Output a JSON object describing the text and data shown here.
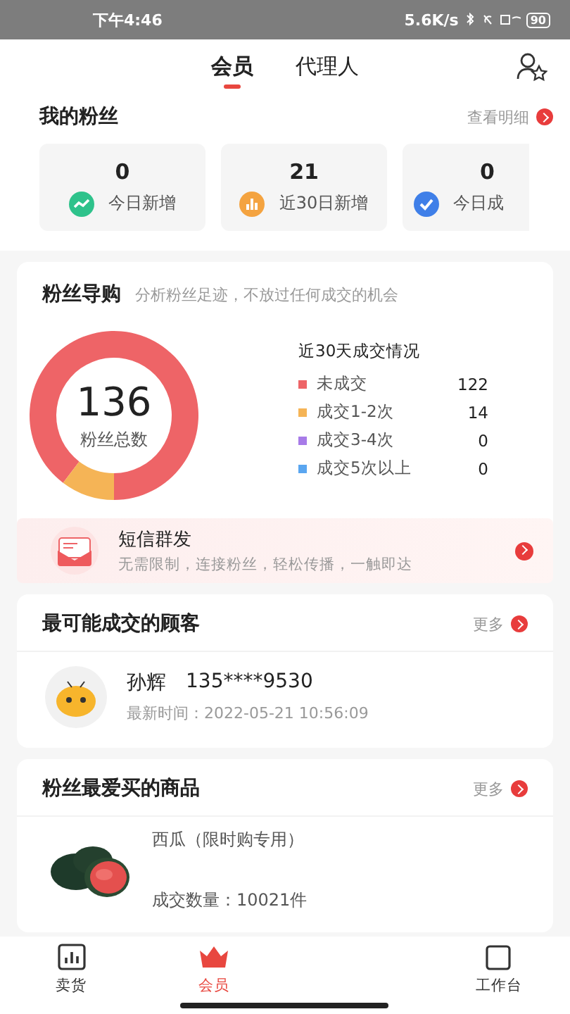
{
  "status_bar": {
    "time": "下午4:46",
    "speed": "5.6K/s",
    "battery": "90"
  },
  "tabs": [
    {
      "label": "会员",
      "selected": true
    },
    {
      "label": "代理人",
      "selected": false
    }
  ],
  "my_fans": {
    "title": "我的粉丝",
    "link": "查看明细",
    "stats": [
      {
        "value": "0",
        "label": "今日新增",
        "kind": "trend",
        "color": "#2ec28b"
      },
      {
        "value": "21",
        "label": "近30日新增",
        "kind": "bars",
        "color": "#f4a340"
      },
      {
        "value": "0",
        "label": "今日成",
        "kind": "check",
        "color": "#3f7fe8"
      }
    ]
  },
  "fan_guide": {
    "title": "粉丝导购",
    "subtitle": "分析粉丝足迹，不放过任何成交的机会",
    "total": "136",
    "total_label": "粉丝总数",
    "legend_title": "近30天成交情况",
    "legend": [
      {
        "count": "122",
        "color": "#ee6467"
      },
      {
        "count": "14",
        "color": "#f5b456"
      },
      {
        "count": "0",
        "color": "#a77be8"
      },
      {
        "count": "0",
        "color": "#5aa6f0"
      }
    ],
    "chart_data": {
      "type": "donut",
      "categories": [
        "未成交",
        "成交1-2次",
        "成交3-4次",
        "成交5次以上"
      ],
      "values": [
        89.7,
        10.3,
        0,
        0
      ]
    },
    "sms": {
      "title": "短信群发",
      "subtitle": "无需限制，连接粉丝，轻松传播，一触即达"
    }
  },
  "customers": {
    "title": "最可能成交的顾客",
    "link": "更多",
    "items": [
      {
        "name": "孙辉",
        "phone": "135****9530",
        "time": "最新时间：2022-05-21 10:56:09"
      }
    ]
  },
  "products": {
    "title": "粉丝最爱买的商品",
    "link": "更多",
    "items": [
      {
        "name": "西瓜（限时购专用）",
        "sales": "成交数量：10021件"
      }
    ]
  },
  "nav": [
    {
      "label": "卖货",
      "kind": "chart",
      "selected": false
    },
    {
      "label": "会员",
      "kind": "crown",
      "selected": true
    },
    {
      "label": "工作台",
      "kind": "grid",
      "selected": false
    }
  ]
}
